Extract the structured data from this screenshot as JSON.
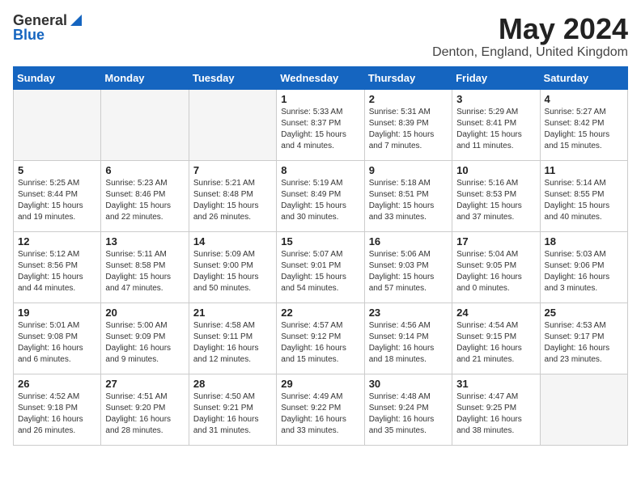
{
  "header": {
    "logo_general": "General",
    "logo_blue": "Blue",
    "month": "May 2024",
    "location": "Denton, England, United Kingdom"
  },
  "weekdays": [
    "Sunday",
    "Monday",
    "Tuesday",
    "Wednesday",
    "Thursday",
    "Friday",
    "Saturday"
  ],
  "weeks": [
    [
      {
        "day": "",
        "info": ""
      },
      {
        "day": "",
        "info": ""
      },
      {
        "day": "",
        "info": ""
      },
      {
        "day": "1",
        "info": "Sunrise: 5:33 AM\nSunset: 8:37 PM\nDaylight: 15 hours\nand 4 minutes."
      },
      {
        "day": "2",
        "info": "Sunrise: 5:31 AM\nSunset: 8:39 PM\nDaylight: 15 hours\nand 7 minutes."
      },
      {
        "day": "3",
        "info": "Sunrise: 5:29 AM\nSunset: 8:41 PM\nDaylight: 15 hours\nand 11 minutes."
      },
      {
        "day": "4",
        "info": "Sunrise: 5:27 AM\nSunset: 8:42 PM\nDaylight: 15 hours\nand 15 minutes."
      }
    ],
    [
      {
        "day": "5",
        "info": "Sunrise: 5:25 AM\nSunset: 8:44 PM\nDaylight: 15 hours\nand 19 minutes."
      },
      {
        "day": "6",
        "info": "Sunrise: 5:23 AM\nSunset: 8:46 PM\nDaylight: 15 hours\nand 22 minutes."
      },
      {
        "day": "7",
        "info": "Sunrise: 5:21 AM\nSunset: 8:48 PM\nDaylight: 15 hours\nand 26 minutes."
      },
      {
        "day": "8",
        "info": "Sunrise: 5:19 AM\nSunset: 8:49 PM\nDaylight: 15 hours\nand 30 minutes."
      },
      {
        "day": "9",
        "info": "Sunrise: 5:18 AM\nSunset: 8:51 PM\nDaylight: 15 hours\nand 33 minutes."
      },
      {
        "day": "10",
        "info": "Sunrise: 5:16 AM\nSunset: 8:53 PM\nDaylight: 15 hours\nand 37 minutes."
      },
      {
        "day": "11",
        "info": "Sunrise: 5:14 AM\nSunset: 8:55 PM\nDaylight: 15 hours\nand 40 minutes."
      }
    ],
    [
      {
        "day": "12",
        "info": "Sunrise: 5:12 AM\nSunset: 8:56 PM\nDaylight: 15 hours\nand 44 minutes."
      },
      {
        "day": "13",
        "info": "Sunrise: 5:11 AM\nSunset: 8:58 PM\nDaylight: 15 hours\nand 47 minutes."
      },
      {
        "day": "14",
        "info": "Sunrise: 5:09 AM\nSunset: 9:00 PM\nDaylight: 15 hours\nand 50 minutes."
      },
      {
        "day": "15",
        "info": "Sunrise: 5:07 AM\nSunset: 9:01 PM\nDaylight: 15 hours\nand 54 minutes."
      },
      {
        "day": "16",
        "info": "Sunrise: 5:06 AM\nSunset: 9:03 PM\nDaylight: 15 hours\nand 57 minutes."
      },
      {
        "day": "17",
        "info": "Sunrise: 5:04 AM\nSunset: 9:05 PM\nDaylight: 16 hours\nand 0 minutes."
      },
      {
        "day": "18",
        "info": "Sunrise: 5:03 AM\nSunset: 9:06 PM\nDaylight: 16 hours\nand 3 minutes."
      }
    ],
    [
      {
        "day": "19",
        "info": "Sunrise: 5:01 AM\nSunset: 9:08 PM\nDaylight: 16 hours\nand 6 minutes."
      },
      {
        "day": "20",
        "info": "Sunrise: 5:00 AM\nSunset: 9:09 PM\nDaylight: 16 hours\nand 9 minutes."
      },
      {
        "day": "21",
        "info": "Sunrise: 4:58 AM\nSunset: 9:11 PM\nDaylight: 16 hours\nand 12 minutes."
      },
      {
        "day": "22",
        "info": "Sunrise: 4:57 AM\nSunset: 9:12 PM\nDaylight: 16 hours\nand 15 minutes."
      },
      {
        "day": "23",
        "info": "Sunrise: 4:56 AM\nSunset: 9:14 PM\nDaylight: 16 hours\nand 18 minutes."
      },
      {
        "day": "24",
        "info": "Sunrise: 4:54 AM\nSunset: 9:15 PM\nDaylight: 16 hours\nand 21 minutes."
      },
      {
        "day": "25",
        "info": "Sunrise: 4:53 AM\nSunset: 9:17 PM\nDaylight: 16 hours\nand 23 minutes."
      }
    ],
    [
      {
        "day": "26",
        "info": "Sunrise: 4:52 AM\nSunset: 9:18 PM\nDaylight: 16 hours\nand 26 minutes."
      },
      {
        "day": "27",
        "info": "Sunrise: 4:51 AM\nSunset: 9:20 PM\nDaylight: 16 hours\nand 28 minutes."
      },
      {
        "day": "28",
        "info": "Sunrise: 4:50 AM\nSunset: 9:21 PM\nDaylight: 16 hours\nand 31 minutes."
      },
      {
        "day": "29",
        "info": "Sunrise: 4:49 AM\nSunset: 9:22 PM\nDaylight: 16 hours\nand 33 minutes."
      },
      {
        "day": "30",
        "info": "Sunrise: 4:48 AM\nSunset: 9:24 PM\nDaylight: 16 hours\nand 35 minutes."
      },
      {
        "day": "31",
        "info": "Sunrise: 4:47 AM\nSunset: 9:25 PM\nDaylight: 16 hours\nand 38 minutes."
      },
      {
        "day": "",
        "info": ""
      }
    ]
  ]
}
